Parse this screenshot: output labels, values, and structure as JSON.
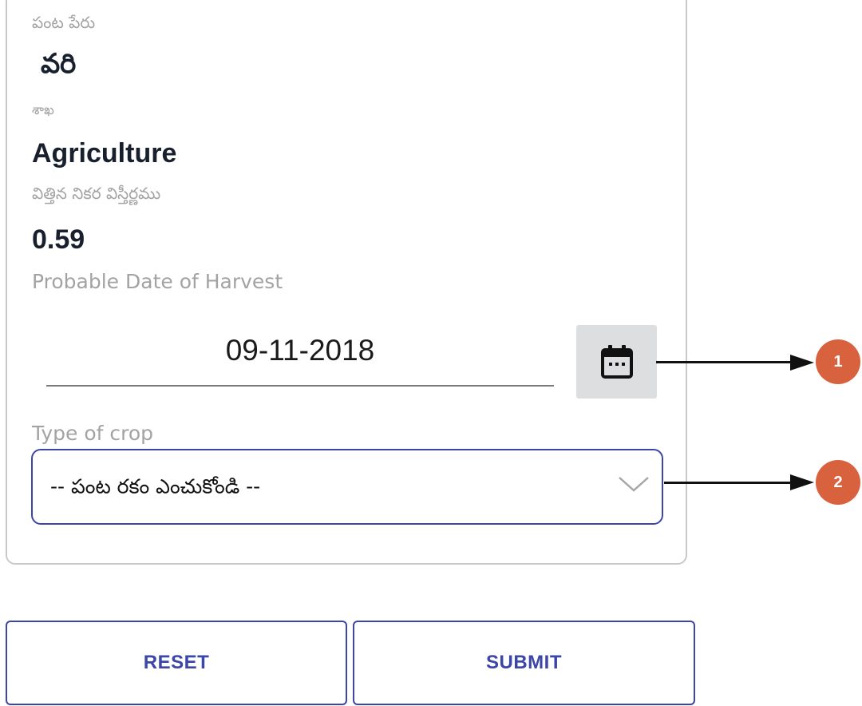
{
  "form": {
    "crop_name_label": "పంట పేరు",
    "crop_name_value": "వరి",
    "department_label": "శాఖ",
    "department_value": "Agriculture",
    "sown_area_label": "విత్తిన నికర విస్తీర్ణము",
    "sown_area_value": "0.59",
    "harvest_date_label": "Probable Date of Harvest",
    "harvest_date_value": "09-11-2018",
    "crop_type_label": "Type of crop",
    "crop_type_selected": "-- పంట రకం ఎంచుకోండి --"
  },
  "annotations": {
    "badge_1": "1",
    "badge_2": "2",
    "badge_color": "#d8613e"
  },
  "buttons": {
    "reset_label": "RESET",
    "submit_label": "SUBMIT"
  },
  "colors": {
    "accent": "#3b46a8",
    "label_gray": "#a3a3a3",
    "value_dark": "#18202e",
    "calendar_bg": "#dddedf"
  },
  "icons": {
    "calendar": "calendar-icon",
    "dropdown": "chevron-down-icon"
  }
}
